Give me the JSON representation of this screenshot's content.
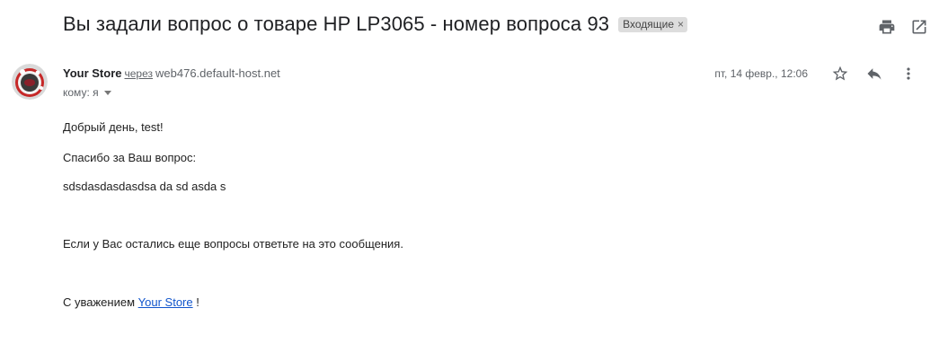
{
  "email": {
    "subject": "Вы задали вопрос о товаре HP LP3065 - номер вопроса 93",
    "label": {
      "name": "Входящие",
      "remove_symbol": "×"
    },
    "sender": {
      "name": "Your Store",
      "via_label": "через",
      "via_host": "web476.default-host.net"
    },
    "recipient_text": "кому: я",
    "date": "пт, 14 февр., 12:06",
    "body": {
      "greeting": "Добрый день, test!",
      "thanks": "Спасибо за Ваш вопрос:",
      "question": "sdsdasdasdasdsa da sd asda s",
      "followup": "Если у Вас остались еще вопросы ответьте на это сообщения.",
      "signoff_prefix": "С уважением",
      "signoff_link": "Your Store",
      "signoff_suffix": "!"
    }
  },
  "icons": {
    "print": "print-icon",
    "open_new_window": "open-in-new-window-icon",
    "star": "star-icon",
    "reply": "reply-icon",
    "more": "more-vert-icon"
  },
  "colors": {
    "link": "#1155cc",
    "muted_text": "#5f6368",
    "chip_bg": "#dddddd",
    "avatar_accent": "#c62828"
  }
}
